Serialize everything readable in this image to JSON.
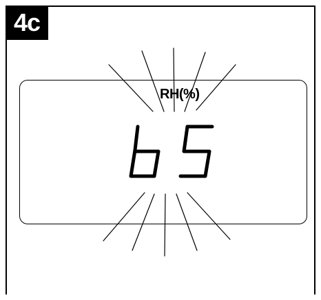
{
  "step": {
    "label": "4c"
  },
  "display": {
    "unit_label": "RH(%)",
    "reading": "b5",
    "state": "blinking"
  },
  "colors": {
    "ink": "#000000",
    "badge_background": "#000000",
    "badge_text": "#ffffff"
  }
}
